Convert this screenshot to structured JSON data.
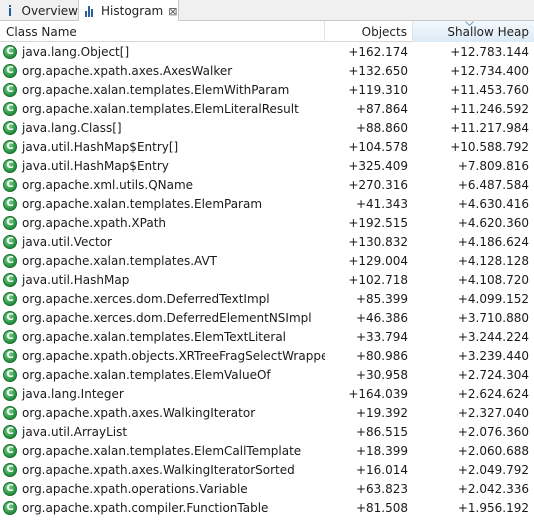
{
  "tabs": [
    {
      "label": "Overview",
      "icon": "info-icon"
    },
    {
      "label": "Histogram",
      "icon": "histogram-icon",
      "close": "⊠",
      "active": true
    }
  ],
  "columns": {
    "class_name": "Class Name",
    "objects": "Objects",
    "shallow_heap": "Shallow Heap",
    "sorted_by": "Shallow Heap"
  },
  "icon_letter": "C",
  "colors": {
    "class_icon": "#1f8a3a",
    "sort_header": "#dcebf7"
  },
  "rows": [
    {
      "name": "java.lang.Object[]",
      "objects": "+162.174",
      "heap": "+12.783.144"
    },
    {
      "name": "org.apache.xpath.axes.AxesWalker",
      "objects": "+132.650",
      "heap": "+12.734.400"
    },
    {
      "name": "org.apache.xalan.templates.ElemWithParam",
      "objects": "+119.310",
      "heap": "+11.453.760"
    },
    {
      "name": "org.apache.xalan.templates.ElemLiteralResult",
      "objects": "+87.864",
      "heap": "+11.246.592"
    },
    {
      "name": "java.lang.Class[]",
      "objects": "+88.860",
      "heap": "+11.217.984"
    },
    {
      "name": "java.util.HashMap$Entry[]",
      "objects": "+104.578",
      "heap": "+10.588.792"
    },
    {
      "name": "java.util.HashMap$Entry",
      "objects": "+325.409",
      "heap": "+7.809.816"
    },
    {
      "name": "org.apache.xml.utils.QName",
      "objects": "+270.316",
      "heap": "+6.487.584"
    },
    {
      "name": "org.apache.xalan.templates.ElemParam",
      "objects": "+41.343",
      "heap": "+4.630.416"
    },
    {
      "name": "org.apache.xpath.XPath",
      "objects": "+192.515",
      "heap": "+4.620.360"
    },
    {
      "name": "java.util.Vector",
      "objects": "+130.832",
      "heap": "+4.186.624"
    },
    {
      "name": "org.apache.xalan.templates.AVT",
      "objects": "+129.004",
      "heap": "+4.128.128"
    },
    {
      "name": "java.util.HashMap",
      "objects": "+102.718",
      "heap": "+4.108.720"
    },
    {
      "name": "org.apache.xerces.dom.DeferredTextImpl",
      "objects": "+85.399",
      "heap": "+4.099.152"
    },
    {
      "name": "org.apache.xerces.dom.DeferredElementNSImpl",
      "objects": "+46.386",
      "heap": "+3.710.880"
    },
    {
      "name": "org.apache.xalan.templates.ElemTextLiteral",
      "objects": "+33.794",
      "heap": "+3.244.224"
    },
    {
      "name": "org.apache.xpath.objects.XRTreeFragSelectWrapper",
      "objects": "+80.986",
      "heap": "+3.239.440"
    },
    {
      "name": "org.apache.xalan.templates.ElemValueOf",
      "objects": "+30.958",
      "heap": "+2.724.304"
    },
    {
      "name": "java.lang.Integer",
      "objects": "+164.039",
      "heap": "+2.624.624"
    },
    {
      "name": "org.apache.xpath.axes.WalkingIterator",
      "objects": "+19.392",
      "heap": "+2.327.040"
    },
    {
      "name": "java.util.ArrayList",
      "objects": "+86.515",
      "heap": "+2.076.360"
    },
    {
      "name": "org.apache.xalan.templates.ElemCallTemplate",
      "objects": "+18.399",
      "heap": "+2.060.688"
    },
    {
      "name": "org.apache.xpath.axes.WalkingIteratorSorted",
      "objects": "+16.014",
      "heap": "+2.049.792"
    },
    {
      "name": "org.apache.xpath.operations.Variable",
      "objects": "+63.823",
      "heap": "+2.042.336"
    },
    {
      "name": "org.apache.xpath.compiler.FunctionTable",
      "objects": "+81.508",
      "heap": "+1.956.192"
    }
  ]
}
